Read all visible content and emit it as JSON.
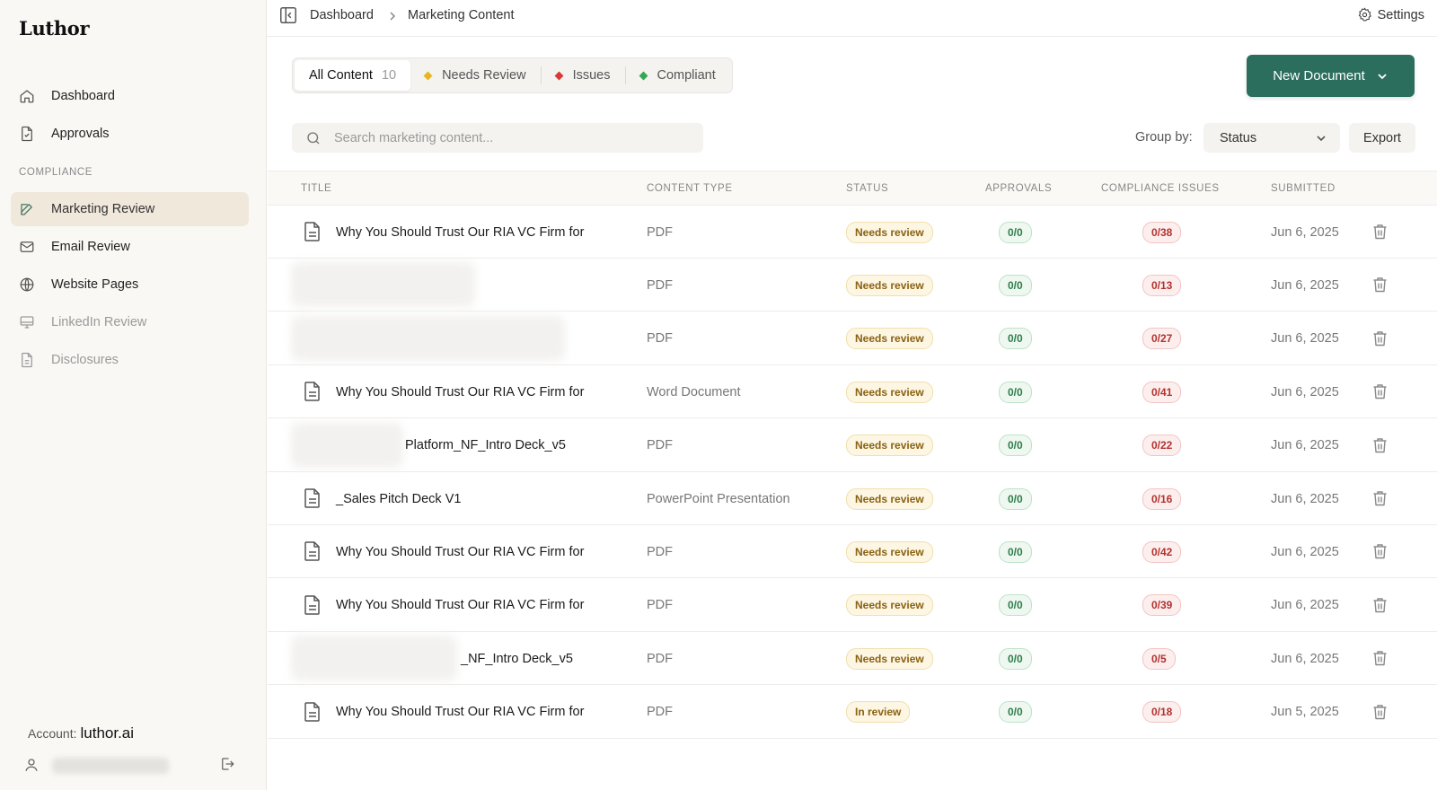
{
  "app": {
    "logo": "Luthor"
  },
  "sidebar": {
    "items": [
      {
        "label": "Dashboard",
        "icon": "home-icon"
      },
      {
        "label": "Approvals",
        "icon": "document-icon"
      }
    ],
    "section_label": "COMPLIANCE",
    "compliance_items": [
      {
        "label": "Marketing Review",
        "icon": "edit-icon",
        "active": true
      },
      {
        "label": "Email Review",
        "icon": "mail-icon"
      },
      {
        "label": "Website Pages",
        "icon": "globe-icon"
      },
      {
        "label": "LinkedIn Review",
        "icon": "monitor-icon",
        "disabled": true
      },
      {
        "label": "Disclosures",
        "icon": "document-icon",
        "disabled": true
      }
    ],
    "account_label": "Account:",
    "account_value": "luthor.ai"
  },
  "topbar": {
    "breadcrumb": [
      "Dashboard",
      "Marketing Content"
    ],
    "settings_label": "Settings"
  },
  "tabs": [
    {
      "label": "All Content",
      "count": "10",
      "active": true
    },
    {
      "label": "Needs Review",
      "color": "#e8b520"
    },
    {
      "label": "Issues",
      "color": "#d63a3a"
    },
    {
      "label": "Compliant",
      "color": "#34a853"
    }
  ],
  "new_document_label": "New Document",
  "search": {
    "placeholder": "Search marketing content..."
  },
  "group_by": {
    "label": "Group by:",
    "value": "Status"
  },
  "export_label": "Export",
  "table": {
    "headers": [
      "TITLE",
      "CONTENT TYPE",
      "STATUS",
      "APPROVALS",
      "COMPLIANCE ISSUES",
      "SUBMITTED"
    ],
    "rows": [
      {
        "title": "Why You Should Trust Our RIA VC Firm for",
        "type": "PDF",
        "status": "Needs review",
        "approvals": "0/0",
        "issues": "0/38",
        "submitted": "Jun 6, 2025"
      },
      {
        "title": "",
        "type": "PDF",
        "status": "Needs review",
        "approvals": "0/0",
        "issues": "0/13",
        "submitted": "Jun 6, 2025"
      },
      {
        "title": "",
        "type": "PDF",
        "status": "Needs review",
        "approvals": "0/0",
        "issues": "0/27",
        "submitted": "Jun 6, 2025"
      },
      {
        "title": "Why You Should Trust Our RIA VC Firm for",
        "type": "Word Document",
        "status": "Needs review",
        "approvals": "0/0",
        "issues": "0/41",
        "submitted": "Jun 6, 2025"
      },
      {
        "title": "Platform_NF_Intro Deck_v5",
        "type": "PDF",
        "status": "Needs review",
        "approvals": "0/0",
        "issues": "0/22",
        "submitted": "Jun 6, 2025"
      },
      {
        "title": "_Sales Pitch Deck V1",
        "type": "PowerPoint Presentation",
        "status": "Needs review",
        "approvals": "0/0",
        "issues": "0/16",
        "submitted": "Jun 6, 2025"
      },
      {
        "title": "Why You Should Trust Our RIA VC Firm for",
        "type": "PDF",
        "status": "Needs review",
        "approvals": "0/0",
        "issues": "0/42",
        "submitted": "Jun 6, 2025"
      },
      {
        "title": "Why You Should Trust Our RIA VC Firm for",
        "type": "PDF",
        "status": "Needs review",
        "approvals": "0/0",
        "issues": "0/39",
        "submitted": "Jun 6, 2025"
      },
      {
        "title": "_NF_Intro Deck_v5",
        "type": "PDF",
        "status": "Needs review",
        "approvals": "0/0",
        "issues": "0/5",
        "submitted": "Jun 6, 2025"
      },
      {
        "title": "Why You Should Trust Our RIA VC Firm for",
        "type": "PDF",
        "status": "In review",
        "approvals": "0/0",
        "issues": "0/18",
        "submitted": "Jun 5, 2025"
      }
    ]
  }
}
